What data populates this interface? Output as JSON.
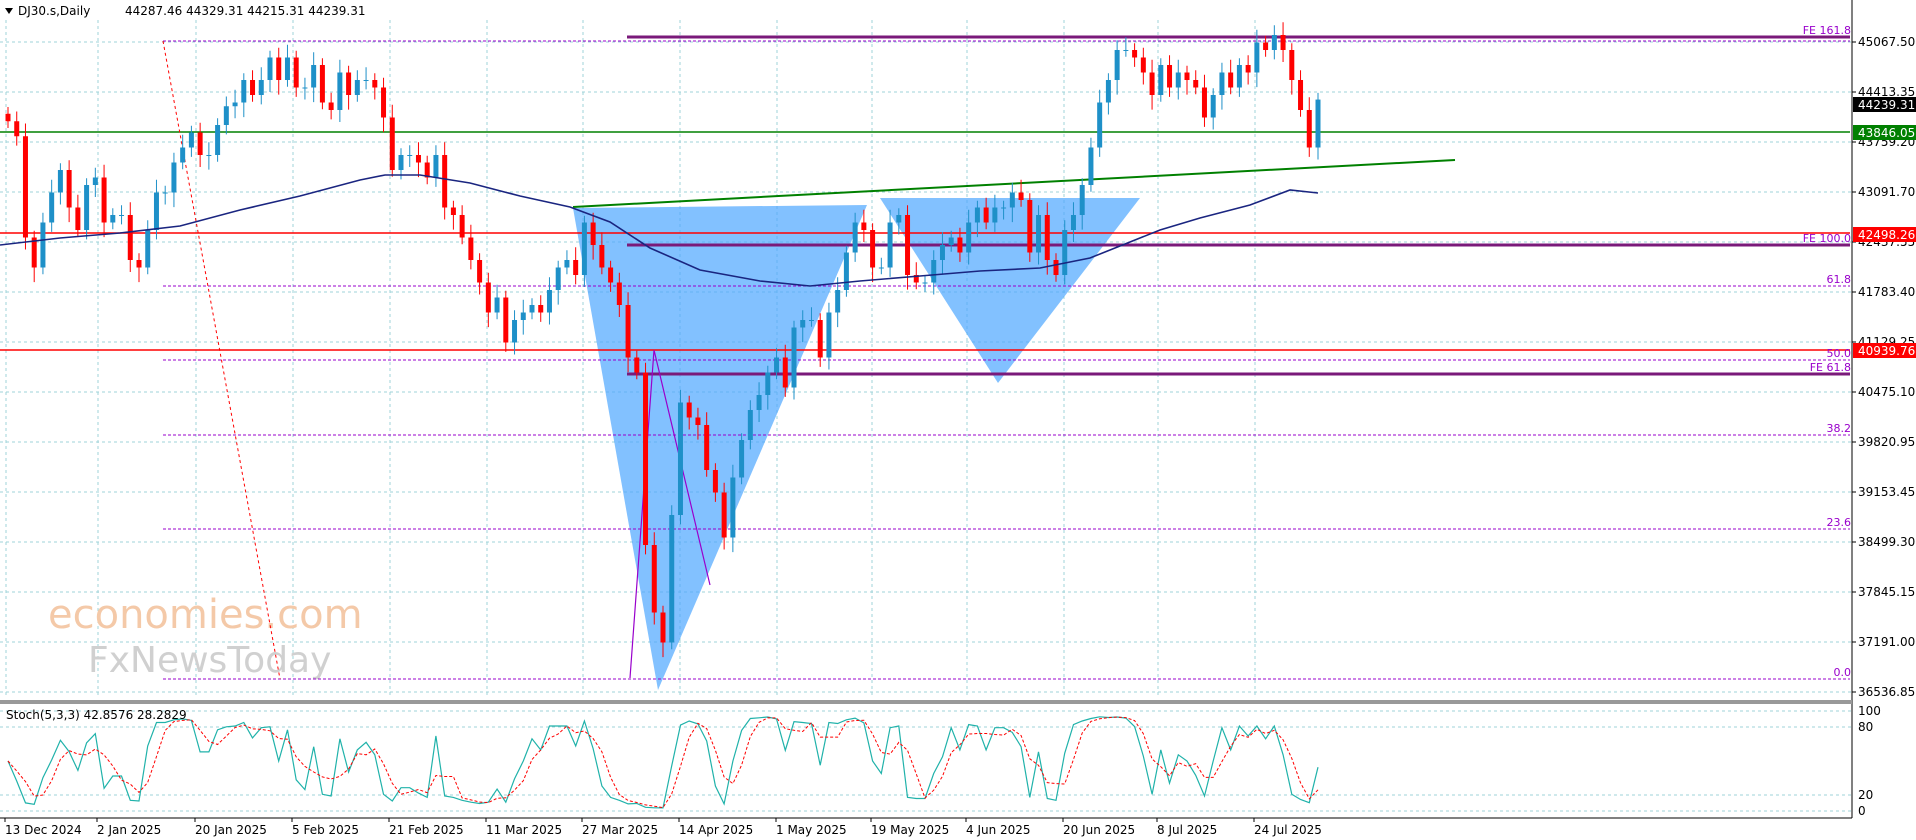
{
  "header": {
    "symbol_tf": "DJ30.s,Daily",
    "ohlc": "44287.46 44329.31 44215.31 44239.31"
  },
  "price_axis": [
    "45067.50",
    "44413.35",
    "43759.20",
    "43091.70",
    "42437.55",
    "41783.40",
    "41129.25",
    "40475.10",
    "39820.95",
    "39153.45",
    "38499.30",
    "37845.15",
    "37191.00",
    "36536.85"
  ],
  "current_price": "44239.31",
  "levels": [
    {
      "label": "43846.05",
      "color": "#008000"
    },
    {
      "label": "42498.26",
      "color": "#ff0000"
    },
    {
      "label": "40939.76",
      "color": "#ff0000"
    }
  ],
  "fib_labels": [
    "FE 161.8",
    "FE 100.0",
    "61.8",
    "50.0",
    "FE 61.8",
    "38.2",
    "23.6",
    "0.0"
  ],
  "stoch": {
    "title": "Stoch(5,3,3) 42.8576 28.2829",
    "axis": [
      "100",
      "80",
      "20",
      "0"
    ]
  },
  "dates": [
    "13 Dec 2024",
    "2 Jan 2025",
    "20 Jan 2025",
    "5 Feb 2025",
    "21 Feb 2025",
    "11 Mar 2025",
    "27 Mar 2025",
    "14 Apr 2025",
    "1 May 2025",
    "19 May 2025",
    "4 Jun 2025",
    "20 Jun 2025",
    "8 Jul 2025",
    "24 Jul 2025"
  ],
  "watermark": {
    "line1": "economies.com",
    "line2": "FxNewsToday"
  },
  "colors": {
    "bull": "#1e90c8",
    "bear": "#ff0000",
    "triangle": "#4da6ff",
    "ma": "#1a2580",
    "fib": "#9900cc",
    "green": "#008000"
  },
  "chart_data": {
    "type": "candlestick",
    "ylim": [
      36300,
      45300
    ],
    "closes": [
      43950,
      43750,
      42400,
      42000,
      42600,
      43000,
      43300,
      42800,
      42500,
      43100,
      43200,
      42600,
      42700,
      42700,
      42100,
      42000,
      42500,
      43000,
      43000,
      43400,
      43600,
      43800,
      43500,
      43500,
      43900,
      44150,
      44200,
      44500,
      44300,
      44500,
      44800,
      44500,
      44800,
      44400,
      44400,
      44700,
      44200,
      44100,
      44600,
      44300,
      44500,
      44500,
      44400,
      44000,
      43300,
      43500,
      43500,
      43400,
      43200,
      43500,
      42800,
      42700,
      42400,
      42100,
      41800,
      41400,
      41600,
      41000,
      41300,
      41400,
      41500,
      41400,
      41700,
      42000,
      42100,
      41900,
      42600,
      42300,
      42000,
      41800,
      41500,
      40800,
      40600,
      38300,
      37400,
      37000,
      38700,
      40200,
      40000,
      39900,
      39300,
      39000,
      38400,
      39200,
      39700,
      40100,
      40300,
      40600,
      40800,
      40400,
      41200,
      41300,
      41300,
      40800,
      41400,
      41700,
      42200,
      42600,
      42500,
      42000,
      42000,
      42600,
      42700,
      41900,
      41800,
      41800,
      42100,
      42300,
      42400,
      42200,
      42600,
      42800,
      42600,
      42800,
      42800,
      43000,
      42900,
      42200,
      42700,
      42100,
      41900,
      42500,
      42700,
      43100,
      43600,
      44200,
      44500,
      44900,
      44900,
      44800,
      44600,
      44300,
      44700,
      44400,
      44600,
      44500,
      44400,
      44000,
      44300,
      44600,
      44400,
      44700,
      44600,
      45000,
      44900,
      45100,
      44900,
      44500,
      44100,
      43600,
      44239
    ]
  }
}
